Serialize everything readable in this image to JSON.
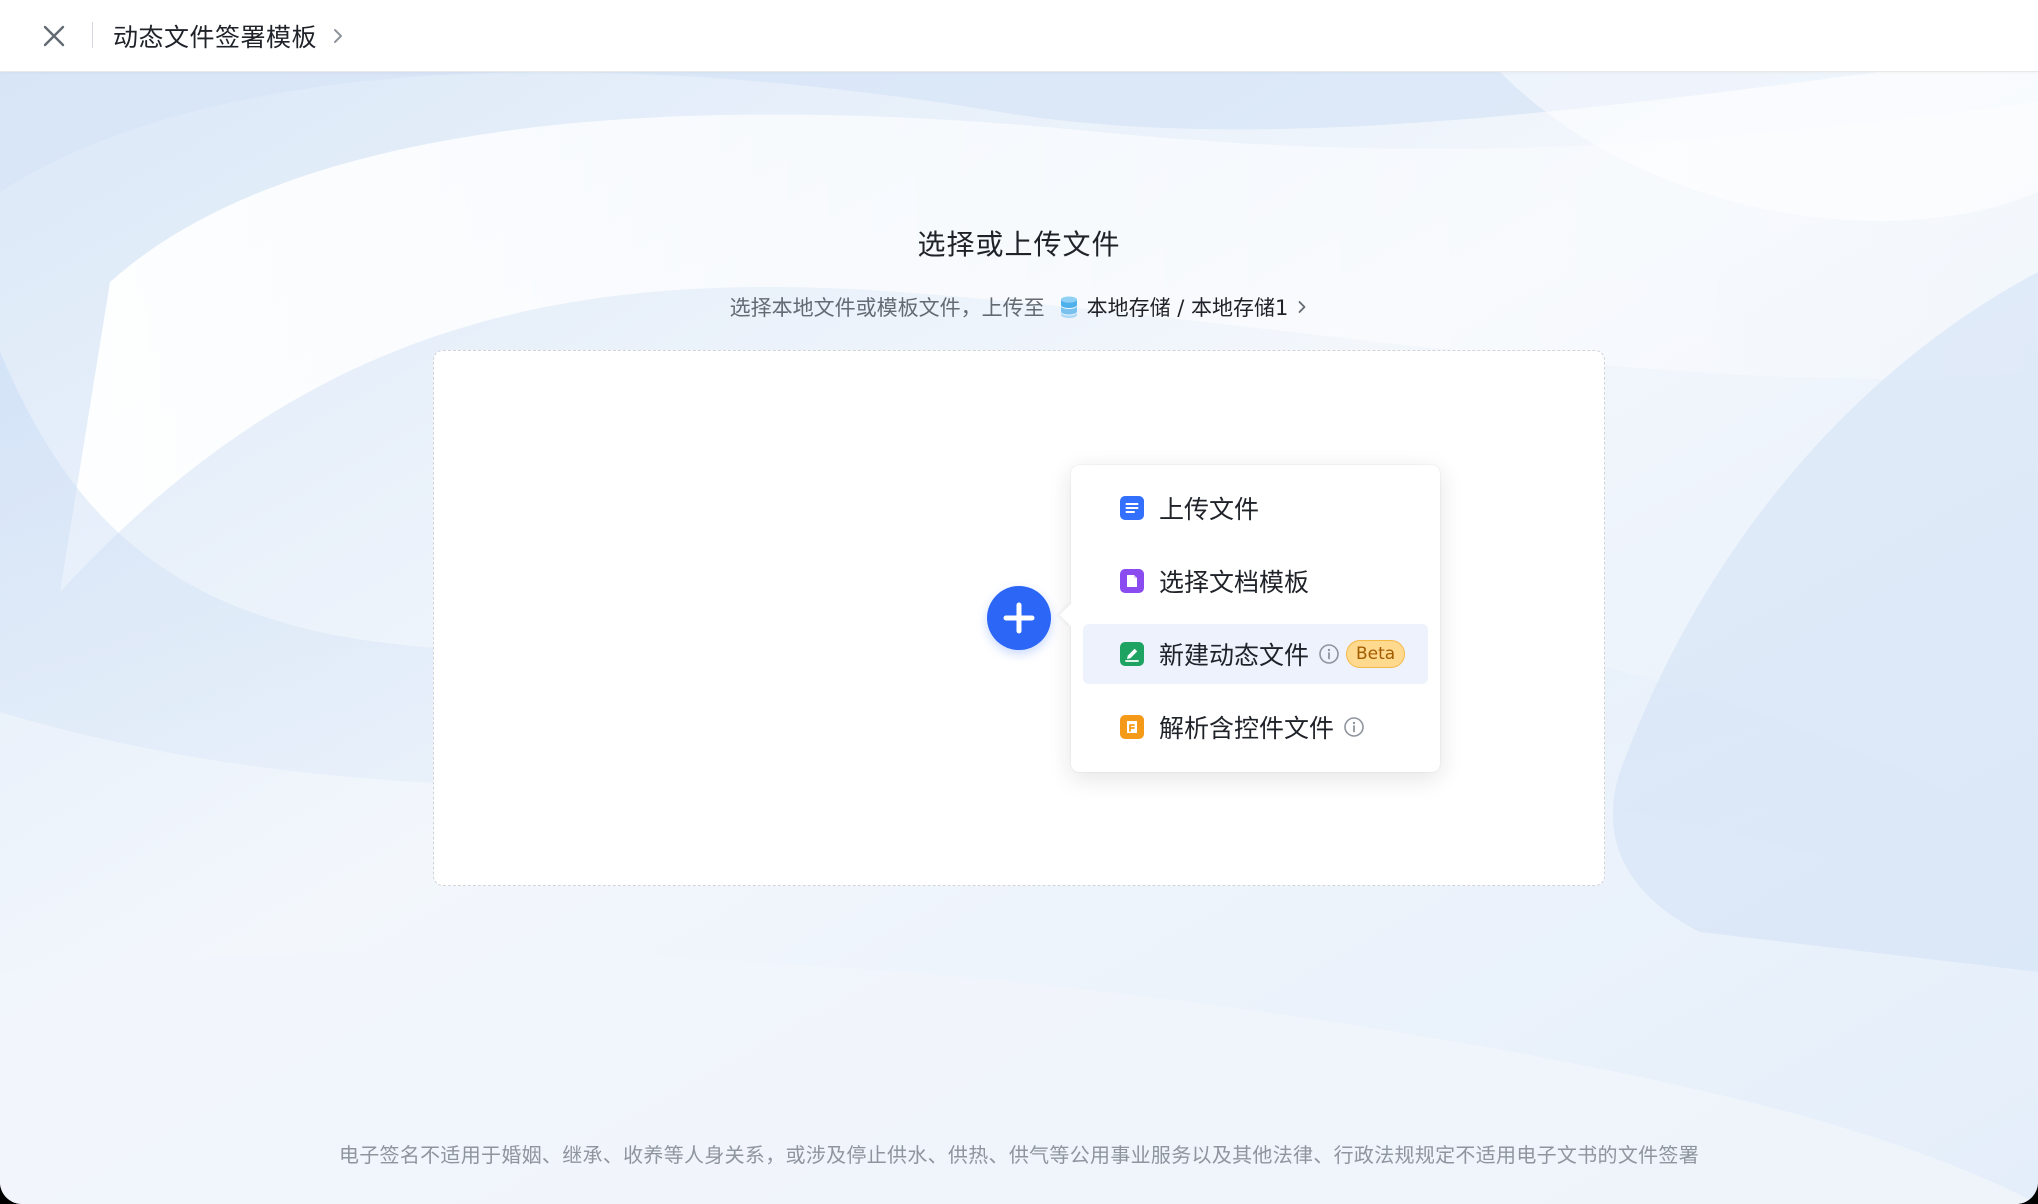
{
  "header": {
    "title": "动态文件签署模板"
  },
  "main": {
    "heading": "选择或上传文件",
    "subtitle_prefix": "选择本地文件或模板文件，上传至",
    "storage_path": "本地存储 / 本地存储1"
  },
  "menu": {
    "items": [
      {
        "label": "上传文件",
        "icon": "doc-lines-icon",
        "color": "#3370ff"
      },
      {
        "label": "选择文档模板",
        "icon": "template-icon",
        "color": "#8a4cf0"
      },
      {
        "label": "新建动态文件",
        "icon": "edit-doc-icon",
        "color": "#1ea362",
        "badge": "Beta",
        "active": true
      },
      {
        "label": "解析含控件文件",
        "icon": "parse-doc-icon",
        "color": "#f59a18"
      }
    ]
  },
  "footer": {
    "note": "电子签名不适用于婚姻、继承、收养等人身关系，或涉及停止供水、供热、供气等公用事业服务以及其他法律、行政法规规定不适用电子文书的文件签署"
  },
  "colors": {
    "accent": "#2b66f6",
    "beta_bg": "#ffd98e"
  }
}
